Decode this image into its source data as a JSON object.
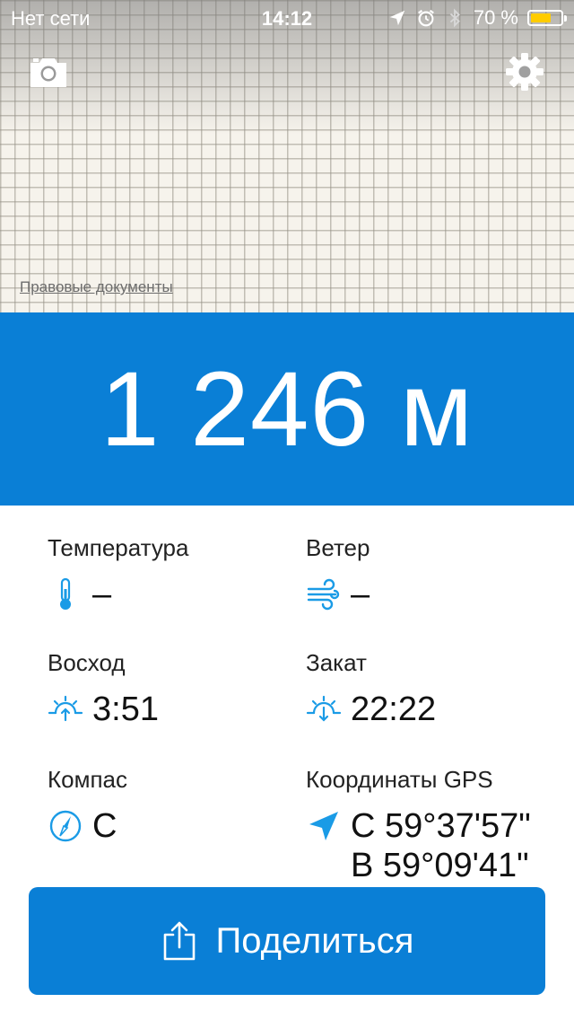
{
  "status_bar": {
    "carrier": "Нет сети",
    "time": "14:12",
    "battery_percent": "70 %",
    "battery_level": 0.7,
    "icons": [
      "location-arrow-icon",
      "alarm-icon",
      "bluetooth-icon",
      "battery-icon"
    ]
  },
  "map": {
    "legal_link": "Правовые документы",
    "camera_icon": "camera-icon",
    "settings_icon": "gear-icon"
  },
  "altitude": {
    "value": "1 246 м"
  },
  "info": {
    "temperature": {
      "label": "Температура",
      "value": "–",
      "icon": "thermometer-icon"
    },
    "wind": {
      "label": "Ветер",
      "value": "–",
      "icon": "wind-icon"
    },
    "sunrise": {
      "label": "Восход",
      "value": "3:51",
      "icon": "sunrise-icon"
    },
    "sunset": {
      "label": "Закат",
      "value": "22:22",
      "icon": "sunset-icon"
    },
    "compass": {
      "label": "Компас",
      "value": "С",
      "icon": "compass-icon"
    },
    "gps": {
      "label": "Координаты GPS",
      "lat": "С 59°37'57\"",
      "lon": "В 59°09'41\"",
      "icon": "location-arrow-icon"
    }
  },
  "share": {
    "label": "Поделиться",
    "icon": "share-icon"
  },
  "colors": {
    "accent": "#0a7fd6",
    "icon_blue": "#1a9be6",
    "battery": "#ffcc00"
  }
}
